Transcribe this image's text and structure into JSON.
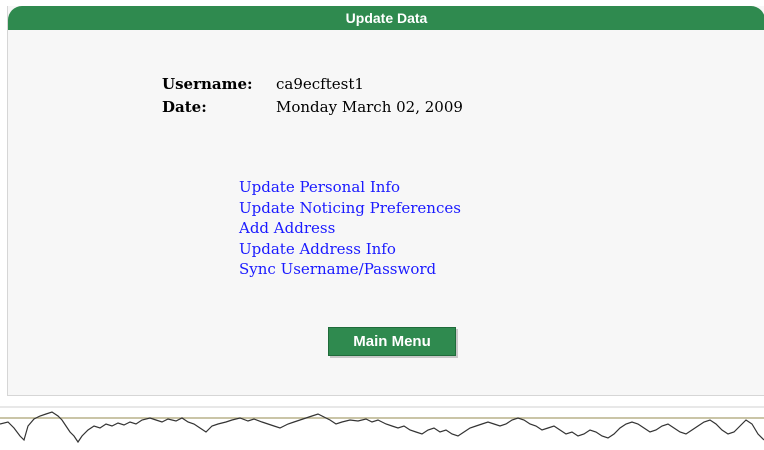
{
  "header": {
    "title": "Update Data"
  },
  "info": {
    "username_label": "Username:",
    "username_value": "ca9ecftest1",
    "date_label": "Date:",
    "date_value": "Monday March 02, 2009"
  },
  "links": [
    "Update Personal Info",
    "Update Noticing Preferences",
    "Add Address",
    "Update Address Info",
    "Sync Username/Password"
  ],
  "main_menu_label": "Main Menu",
  "colors": {
    "header_green": "#2f8a4f",
    "link_blue": "#1a1aff"
  }
}
